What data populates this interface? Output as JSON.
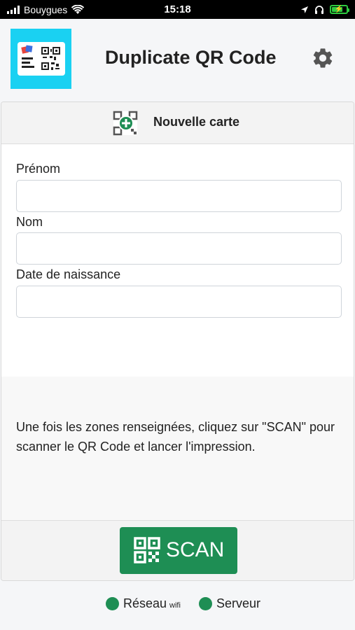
{
  "status_bar": {
    "carrier": "Bouygues",
    "time": "15:18",
    "battery_level": 0.7,
    "icons": [
      "signal-icon",
      "wifi-icon",
      "location-icon",
      "headphones-icon",
      "battery-charging-icon"
    ]
  },
  "header": {
    "title": "Duplicate QR Code",
    "logo_icon": "qr-card-logo-icon",
    "settings_icon": "gear-icon"
  },
  "card": {
    "title": "Nouvelle carte",
    "title_icon": "add-qr-icon"
  },
  "form": {
    "fields": [
      {
        "label": "Prénom",
        "value": ""
      },
      {
        "label": "Nom",
        "value": ""
      },
      {
        "label": "Date de naissance",
        "value": ""
      }
    ]
  },
  "info": {
    "text": "Une fois les zones renseignées, cliquez sur \"SCAN\" pour scanner le QR Code et lancer l'impression."
  },
  "actions": {
    "scan_label": "SCAN",
    "scan_icon": "qr-code-icon"
  },
  "status_indicators": {
    "network_label": "Réseau",
    "network_type": "wifi",
    "server_label": "Serveur",
    "color": "#1e8e54"
  },
  "colors": {
    "accent": "#1e8e54",
    "logo_background": "#1ad1f2"
  }
}
